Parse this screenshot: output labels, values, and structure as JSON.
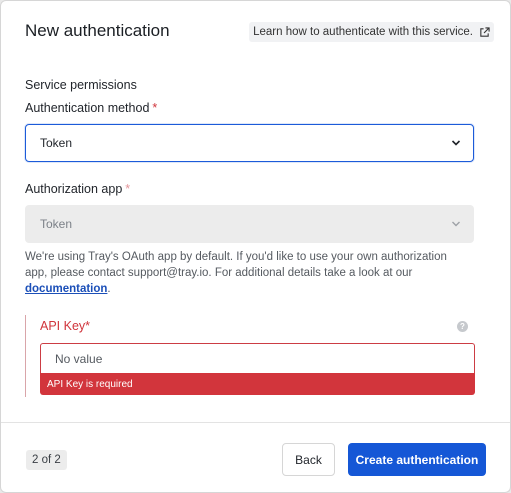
{
  "modal": {
    "title": "New authentication",
    "learn_link": "Learn how to authenticate with this service."
  },
  "form": {
    "section_label": "Service permissions",
    "auth_method": {
      "label": "Authentication method",
      "required_mark": "*",
      "value": "Token"
    },
    "auth_app": {
      "label": "Authorization app",
      "required_mark": "*",
      "value": "Token",
      "disabled": true
    },
    "help": {
      "text": "We're using Tray's OAuth app by default. If you'd like to use your own authorization app, please contact support@tray.io. For additional details take a look at our ",
      "link": "documentation",
      "suffix": "."
    },
    "api_key": {
      "label": "API Key",
      "required_mark": "*",
      "help_glyph": "?",
      "placeholder": "No value",
      "error": "API Key is required"
    }
  },
  "footer": {
    "step": "2 of 2",
    "back_label": "Back",
    "create_label": "Create authentication"
  },
  "colors": {
    "primary": "#1557d6",
    "error": "#d2353c",
    "link": "#1b4fb8"
  },
  "icons": {
    "external": "external-link-icon",
    "chevron": "chevron-down-icon",
    "help": "help-circle-icon"
  }
}
